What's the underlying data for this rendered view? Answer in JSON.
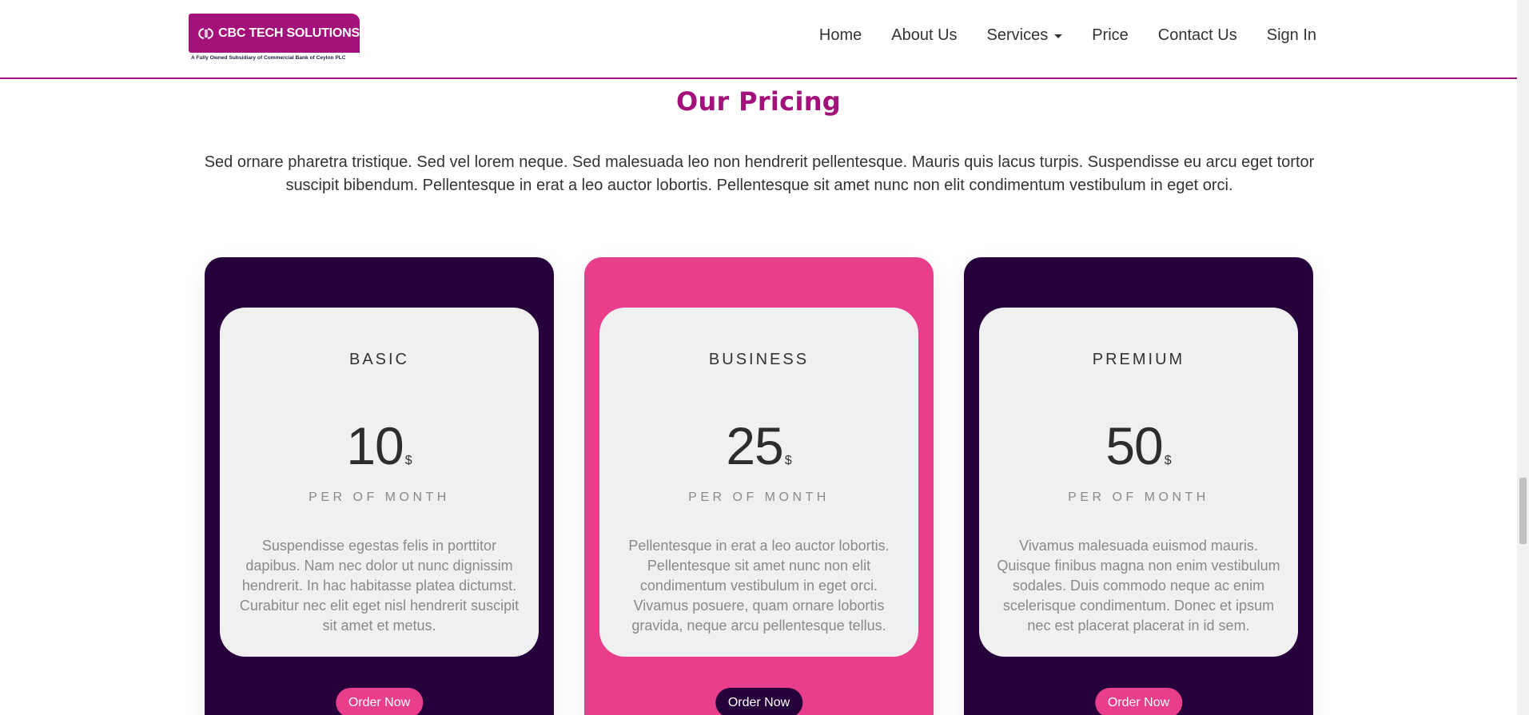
{
  "brand": {
    "name": "CBC TECH SOLUTIONS",
    "tagline": "A Fully Owned Subsidiary of Commercial Bank of Ceylon PLC",
    "color": "#a3117a"
  },
  "nav": {
    "home": "Home",
    "about": "About Us",
    "services": "Services",
    "price": "Price",
    "contact": "Contact Us",
    "signin": "Sign In"
  },
  "section": {
    "title": "Our Pricing",
    "intro": "Sed ornare pharetra tristique. Sed vel lorem neque. Sed malesuada leo non hendrerit pellentesque. Mauris quis lacus turpis. Suspendisse eu arcu eget tortor suscipit bibendum. Pellentesque in erat a leo auctor lobortis. Pellentesque sit amet nunc non elit condimentum vestibulum in eget orci."
  },
  "plans": [
    {
      "name": "BASIC",
      "price": "10",
      "currency": "$",
      "period": "PER OF MONTH",
      "description": "Suspendisse egestas felis in porttitor dapibus. Nam nec dolor ut nunc dignissim hendrerit. In hac habitasse platea dictumst. Curabitur nec elit eget nisl hendrerit suscipit sit amet et metus.",
      "button": "Order Now"
    },
    {
      "name": "BUSINESS",
      "price": "25",
      "currency": "$",
      "period": "PER OF MONTH",
      "description": "Pellentesque in erat a leo auctor lobortis. Pellentesque sit amet nunc non elit condimentum vestibulum in eget orci. Vivamus posuere, quam ornare lobortis gravida, neque arcu pellentesque tellus.",
      "button": "Order Now"
    },
    {
      "name": "PREMIUM",
      "price": "50",
      "currency": "$",
      "period": "PER OF MONTH",
      "description": "Vivamus malesuada euismod mauris. Quisque finibus magna non enim vestibulum sodales. Duis commodo neque ac enim scelerisque condimentum. Donec et ipsum nec est placerat placerat in id sem.",
      "button": "Order Now"
    }
  ],
  "colors": {
    "dark": "#26003a",
    "pink": "#e83e8c"
  }
}
